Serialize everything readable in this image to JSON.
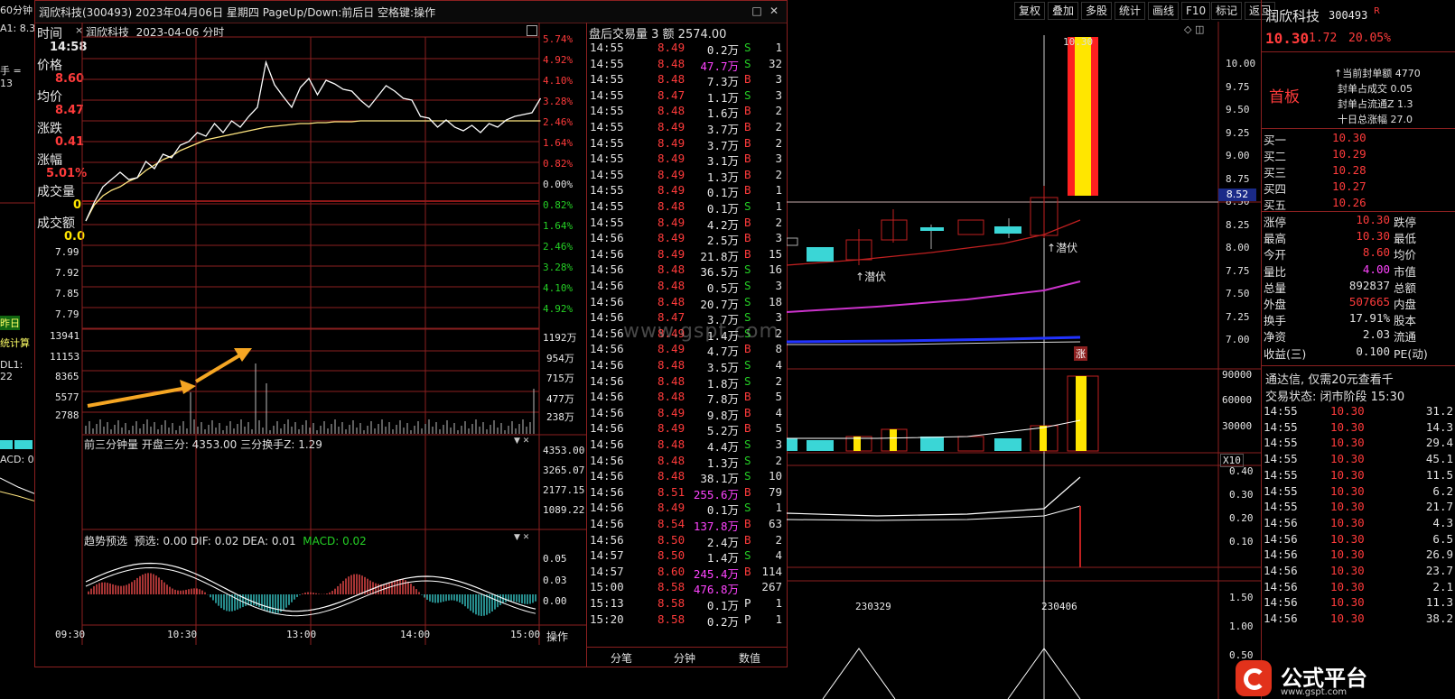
{
  "left_strip": {
    "items": [
      "60分钟",
      "A1: 8.3",
      "手 = 13",
      "昨日",
      "统计算",
      "DL1: 22",
      "ACD: 0"
    ]
  },
  "popup": {
    "title": "润欣科技(300493) 2023年04月06日 星期四 PageUp/Down:前后日 空格键:操作",
    "subtitle_stock": "润欣科技",
    "subtitle_date": "2023-04-06 分时",
    "info": {
      "time_label": "时间",
      "time_value": "14:58",
      "price_label": "价格",
      "price_value": "8.60",
      "avg_label": "均价",
      "avg_value": "8.47",
      "change_label": "涨跌",
      "change_value": "0.41",
      "pct_label": "涨幅",
      "pct_value": "5.01%",
      "vol_label": "成交量",
      "vol_value": "0",
      "amt_label": "成交额",
      "amt_value": "0.0"
    },
    "price_ticks_left": [
      "7.99",
      "7.92",
      "7.85",
      "7.79"
    ],
    "pct_ticks_right": [
      "5.74%",
      "4.92%",
      "4.10%",
      "3.28%",
      "2.46%",
      "1.64%",
      "0.82%",
      "0.00%",
      "0.82%",
      "1.64%",
      "2.46%",
      "3.28%",
      "4.10%",
      "4.92%"
    ],
    "vol_ticks_left": [
      "13941",
      "11153",
      "8365",
      "5577",
      "2788"
    ],
    "vol_ticks_right": [
      "1192万",
      "954万",
      "715万",
      "477万",
      "238万"
    ],
    "sub1_header": "前三分钟量  开盘三分: 4353.00  三分换手Z: 1.29",
    "sub1_ticks": [
      "4353.00",
      "3265.07",
      "2177.15",
      "1089.22"
    ],
    "sub2_header_name": "趋势预选",
    "sub2_header_vals": "预选: 0.00  DIF: 0.02  DEA: 0.01",
    "sub2_macd": "MACD: 0.02",
    "sub2_ticks": [
      "0.05",
      "0.03",
      "0.00"
    ],
    "time_axis": [
      "09:30",
      "10:30",
      "13:00",
      "14:00",
      "15:00"
    ],
    "action_button": "操作",
    "colors": {
      "accent": "#8b2020",
      "price_line": "#ffffff",
      "avg_line": "#ffe680",
      "arrow": "#f5a623"
    }
  },
  "trades": {
    "header": "盘后交易量 3 额 2574.00",
    "rows": [
      {
        "time": "14:55",
        "price": "8.49",
        "vol": "0.2万",
        "side": "S",
        "cnt": "1",
        "pc": "red",
        "vc": "white"
      },
      {
        "time": "14:55",
        "price": "8.48",
        "vol": "47.7万",
        "side": "S",
        "cnt": "32",
        "pc": "red",
        "vc": "magenta"
      },
      {
        "time": "14:55",
        "price": "8.48",
        "vol": "7.3万",
        "side": "B",
        "cnt": "3",
        "pc": "red",
        "vc": "white"
      },
      {
        "time": "14:55",
        "price": "8.47",
        "vol": "1.1万",
        "side": "S",
        "cnt": "3",
        "pc": "red",
        "vc": "white"
      },
      {
        "time": "14:55",
        "price": "8.48",
        "vol": "1.6万",
        "side": "B",
        "cnt": "2",
        "pc": "red",
        "vc": "white"
      },
      {
        "time": "14:55",
        "price": "8.49",
        "vol": "3.7万",
        "side": "B",
        "cnt": "2",
        "pc": "red",
        "vc": "white"
      },
      {
        "time": "14:55",
        "price": "8.49",
        "vol": "3.7万",
        "side": "B",
        "cnt": "2",
        "pc": "red",
        "vc": "white"
      },
      {
        "time": "14:55",
        "price": "8.49",
        "vol": "3.1万",
        "side": "B",
        "cnt": "3",
        "pc": "red",
        "vc": "white"
      },
      {
        "time": "14:55",
        "price": "8.49",
        "vol": "1.3万",
        "side": "B",
        "cnt": "2",
        "pc": "red",
        "vc": "white"
      },
      {
        "time": "14:55",
        "price": "8.49",
        "vol": "0.1万",
        "side": "B",
        "cnt": "1",
        "pc": "red",
        "vc": "white"
      },
      {
        "time": "14:55",
        "price": "8.48",
        "vol": "0.1万",
        "side": "S",
        "cnt": "1",
        "pc": "red",
        "vc": "white"
      },
      {
        "time": "14:55",
        "price": "8.49",
        "vol": "4.2万",
        "side": "B",
        "cnt": "2",
        "pc": "red",
        "vc": "white"
      },
      {
        "time": "14:56",
        "price": "8.49",
        "vol": "2.5万",
        "side": "B",
        "cnt": "3",
        "pc": "red",
        "vc": "white"
      },
      {
        "time": "14:56",
        "price": "8.49",
        "vol": "21.8万",
        "side": "B",
        "cnt": "15",
        "pc": "red",
        "vc": "white"
      },
      {
        "time": "14:56",
        "price": "8.48",
        "vol": "36.5万",
        "side": "S",
        "cnt": "16",
        "pc": "red",
        "vc": "white"
      },
      {
        "time": "14:56",
        "price": "8.48",
        "vol": "0.5万",
        "side": "S",
        "cnt": "3",
        "pc": "red",
        "vc": "white"
      },
      {
        "time": "14:56",
        "price": "8.48",
        "vol": "20.7万",
        "side": "S",
        "cnt": "18",
        "pc": "red",
        "vc": "white"
      },
      {
        "time": "14:56",
        "price": "8.47",
        "vol": "3.7万",
        "side": "S",
        "cnt": "3",
        "pc": "red",
        "vc": "white"
      },
      {
        "time": "14:56",
        "price": "8.49",
        "vol": "1.4万",
        "side": "S",
        "cnt": "2",
        "pc": "red",
        "vc": "white"
      },
      {
        "time": "14:56",
        "price": "8.49",
        "vol": "4.7万",
        "side": "B",
        "cnt": "8",
        "pc": "red",
        "vc": "white"
      },
      {
        "time": "14:56",
        "price": "8.48",
        "vol": "3.5万",
        "side": "S",
        "cnt": "4",
        "pc": "red",
        "vc": "white"
      },
      {
        "time": "14:56",
        "price": "8.48",
        "vol": "1.8万",
        "side": "S",
        "cnt": "2",
        "pc": "red",
        "vc": "white"
      },
      {
        "time": "14:56",
        "price": "8.48",
        "vol": "7.8万",
        "side": "B",
        "cnt": "5",
        "pc": "red",
        "vc": "white"
      },
      {
        "time": "14:56",
        "price": "8.49",
        "vol": "9.8万",
        "side": "B",
        "cnt": "4",
        "pc": "red",
        "vc": "white"
      },
      {
        "time": "14:56",
        "price": "8.49",
        "vol": "5.2万",
        "side": "B",
        "cnt": "5",
        "pc": "red",
        "vc": "white"
      },
      {
        "time": "14:56",
        "price": "8.48",
        "vol": "4.4万",
        "side": "S",
        "cnt": "3",
        "pc": "red",
        "vc": "white"
      },
      {
        "time": "14:56",
        "price": "8.48",
        "vol": "1.3万",
        "side": "S",
        "cnt": "2",
        "pc": "red",
        "vc": "white"
      },
      {
        "time": "14:56",
        "price": "8.48",
        "vol": "38.1万",
        "side": "S",
        "cnt": "10",
        "pc": "red",
        "vc": "white"
      },
      {
        "time": "14:56",
        "price": "8.51",
        "vol": "255.6万",
        "side": "B",
        "cnt": "79",
        "pc": "red",
        "vc": "magenta"
      },
      {
        "time": "14:56",
        "price": "8.49",
        "vol": "0.1万",
        "side": "S",
        "cnt": "1",
        "pc": "red",
        "vc": "white"
      },
      {
        "time": "14:56",
        "price": "8.54",
        "vol": "137.8万",
        "side": "B",
        "cnt": "63",
        "pc": "red",
        "vc": "magenta"
      },
      {
        "time": "14:56",
        "price": "8.50",
        "vol": "2.4万",
        "side": "B",
        "cnt": "2",
        "pc": "red",
        "vc": "white"
      },
      {
        "time": "14:57",
        "price": "8.50",
        "vol": "1.4万",
        "side": "S",
        "cnt": "4",
        "pc": "red",
        "vc": "white"
      },
      {
        "time": "14:57",
        "price": "8.60",
        "vol": "245.4万",
        "side": "B",
        "cnt": "114",
        "pc": "red",
        "vc": "magenta"
      },
      {
        "time": "15:00",
        "price": "8.58",
        "vol": "476.8万",
        "side": "",
        "cnt": "267",
        "pc": "red",
        "vc": "magenta"
      },
      {
        "time": "15:13",
        "price": "8.58",
        "vol": "0.1万",
        "side": "P",
        "cnt": "1",
        "pc": "red",
        "vc": "white"
      },
      {
        "time": "15:20",
        "price": "8.58",
        "vol": "0.2万",
        "side": "P",
        "cnt": "1",
        "pc": "red",
        "vc": "white"
      }
    ],
    "tabs": [
      "分笔",
      "分钟",
      "数值"
    ]
  },
  "toolbar": [
    "复权",
    "叠加",
    "多股",
    "统计",
    "画线",
    "F10",
    "标记",
    "返回"
  ],
  "daily": {
    "price_ticks": [
      "10.00",
      "9.75",
      "9.50",
      "9.25",
      "9.00",
      "8.75",
      "8.50",
      "8.25",
      "8.00",
      "7.75",
      "7.50",
      "7.25",
      "7.00"
    ],
    "current_marker": "8.52",
    "top_label": "10.30",
    "signal_labels": [
      "潜伏",
      "潜伏"
    ],
    "zhang_label": "涨",
    "vol_ticks": [
      "90000",
      "60000",
      "30000"
    ],
    "vol_unit": "X10",
    "ind_ticks": [
      "0.40",
      "0.30",
      "0.20",
      "0.10"
    ],
    "bottom_ticks": [
      "1.50",
      "1.00",
      "0.50"
    ],
    "dates": [
      "230329",
      "230406"
    ]
  },
  "right_panel": {
    "name": "润欣科技",
    "code": "300493",
    "code_suffix": "R",
    "price": "10.30",
    "change": "1.72",
    "pct": "20.05%",
    "board": "首板",
    "seal_items": [
      "当前封单额 4770",
      "封单占成交 0.05",
      "封单占流通Z 1.3",
      "十日总涨幅 27.0"
    ],
    "bids": [
      {
        "label": "买一",
        "price": "10.30"
      },
      {
        "label": "买二",
        "price": "10.29"
      },
      {
        "label": "买三",
        "price": "10.28"
      },
      {
        "label": "买四",
        "price": "10.27"
      },
      {
        "label": "买五",
        "price": "10.26"
      }
    ],
    "stats": [
      {
        "l1": "涨停",
        "v1": "10.30",
        "l2": "跌停",
        "vc": "red"
      },
      {
        "l1": "最高",
        "v1": "10.30",
        "l2": "最低",
        "vc": "red"
      },
      {
        "l1": "今开",
        "v1": "8.60",
        "l2": "均价",
        "vc": "red"
      },
      {
        "l1": "量比",
        "v1": "4.00",
        "l2": "市值",
        "vc": "magenta"
      },
      {
        "l1": "总量",
        "v1": "892837",
        "l2": "总额",
        "vc": "white"
      },
      {
        "l1": "外盘",
        "v1": "507665",
        "l2": "内盘",
        "vc": "red"
      },
      {
        "l1": "换手",
        "v1": "17.91%",
        "l2": "股本",
        "vc": "white"
      },
      {
        "l1": "净资",
        "v1": "2.03",
        "l2": "流通",
        "vc": "white"
      },
      {
        "l1": "收益(三)",
        "v1": "0.100",
        "l2": "PE(动)",
        "vc": "white"
      }
    ],
    "promo": "通达信, 仅需20元查看千",
    "status": "交易状态: 闭市阶段 15:30",
    "ticks": [
      {
        "time": "14:55",
        "price": "10.30",
        "vol": "31.2"
      },
      {
        "time": "14:55",
        "price": "10.30",
        "vol": "14.3"
      },
      {
        "time": "14:55",
        "price": "10.30",
        "vol": "29.4"
      },
      {
        "time": "14:55",
        "price": "10.30",
        "vol": "45.1"
      },
      {
        "time": "14:55",
        "price": "10.30",
        "vol": "11.5"
      },
      {
        "time": "14:55",
        "price": "10.30",
        "vol": "6.2"
      },
      {
        "time": "14:55",
        "price": "10.30",
        "vol": "21.7"
      },
      {
        "time": "14:56",
        "price": "10.30",
        "vol": "4.3"
      },
      {
        "time": "14:56",
        "price": "10.30",
        "vol": "6.5"
      },
      {
        "time": "14:56",
        "price": "10.30",
        "vol": "26.9"
      },
      {
        "time": "14:56",
        "price": "10.30",
        "vol": "23.7"
      },
      {
        "time": "14:56",
        "price": "10.30",
        "vol": "2.1"
      },
      {
        "time": "14:56",
        "price": "10.30",
        "vol": "11.3"
      },
      {
        "time": "14:56",
        "price": "10.30",
        "vol": "38.2"
      }
    ]
  },
  "watermark": "www.gspt.com",
  "brand": {
    "name": "公式平台",
    "url": "www.gspt.com"
  }
}
